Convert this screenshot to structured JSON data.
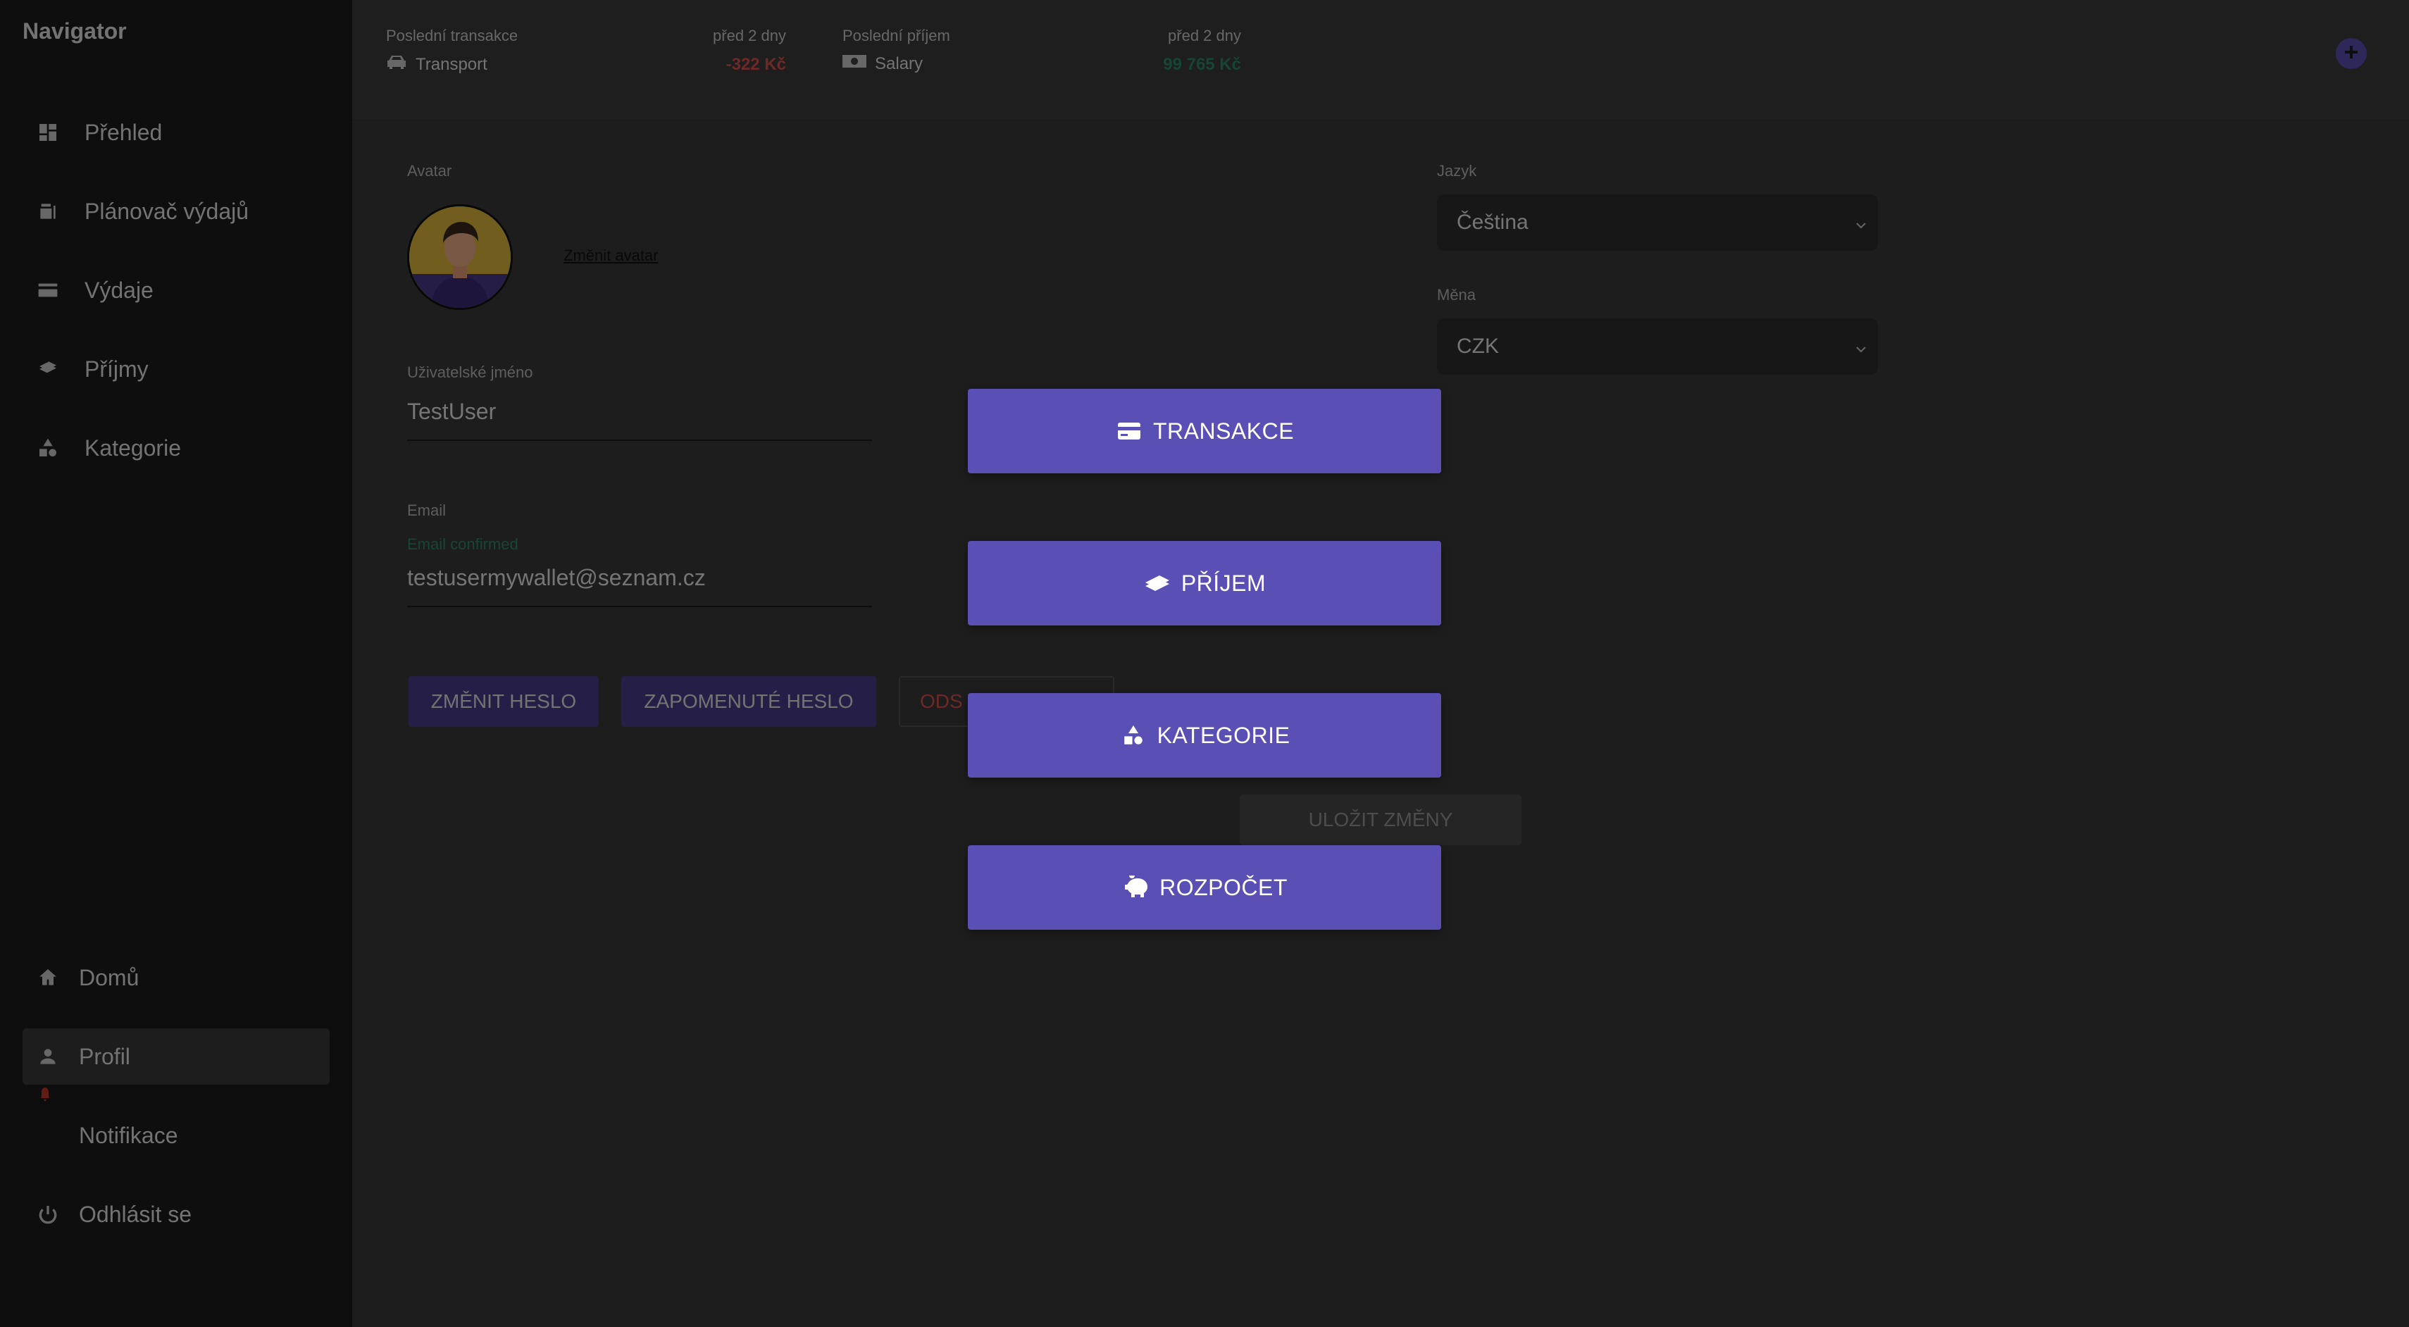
{
  "sidebar": {
    "title": "Navigator",
    "items": [
      {
        "label": "Přehled",
        "icon": "dashboard-icon"
      },
      {
        "label": "Plánovač výdajů",
        "icon": "planner-icon"
      },
      {
        "label": "Výdaje",
        "icon": "credit-card-icon"
      },
      {
        "label": "Příjmy",
        "icon": "money-icon"
      },
      {
        "label": "Kategorie",
        "icon": "shapes-icon"
      }
    ],
    "bottom_items": [
      {
        "label": "Domů",
        "icon": "home-icon"
      },
      {
        "label": "Profil",
        "icon": "person-icon",
        "active": true
      },
      {
        "label": "Notifikace",
        "icon": "bell-icon"
      },
      {
        "label": "Odhlásit se",
        "icon": "power-icon"
      }
    ]
  },
  "topbar": {
    "last_transaction": {
      "label": "Poslední transakce",
      "date": "před 2 dny",
      "category": "Transport",
      "amount": "-322 Kč"
    },
    "last_income": {
      "label": "Poslední příjem",
      "date": "před 2 dny",
      "category": "Salary",
      "amount": "99 765 Kč"
    }
  },
  "profile": {
    "avatar_label": "Avatar",
    "change_avatar": "Změnit avatar",
    "username_label": "Uživatelské jméno",
    "username": "TestUser",
    "email_label": "Email",
    "email_status": "Email confirmed",
    "email": "testusermywallet@seznam.cz",
    "change_password": "ZMĚNIT HESLO",
    "forgot_password": "ZAPOMENUTÉ HESLO",
    "unsubscribe_partial": "ODS",
    "save_changes": "ULOŽIT ZMĚNY",
    "language_label": "Jazyk",
    "language": "Čeština",
    "currency_label": "Měna",
    "currency": "CZK"
  },
  "menu": {
    "transactions": "TRANSAKCE",
    "income": "PŘÍJEM",
    "categories": "KATEGORIE",
    "budget": "ROZPOČET"
  },
  "colors": {
    "accent": "#5a4fb4",
    "negative": "#d9534f",
    "positive": "#2e8b6a"
  }
}
